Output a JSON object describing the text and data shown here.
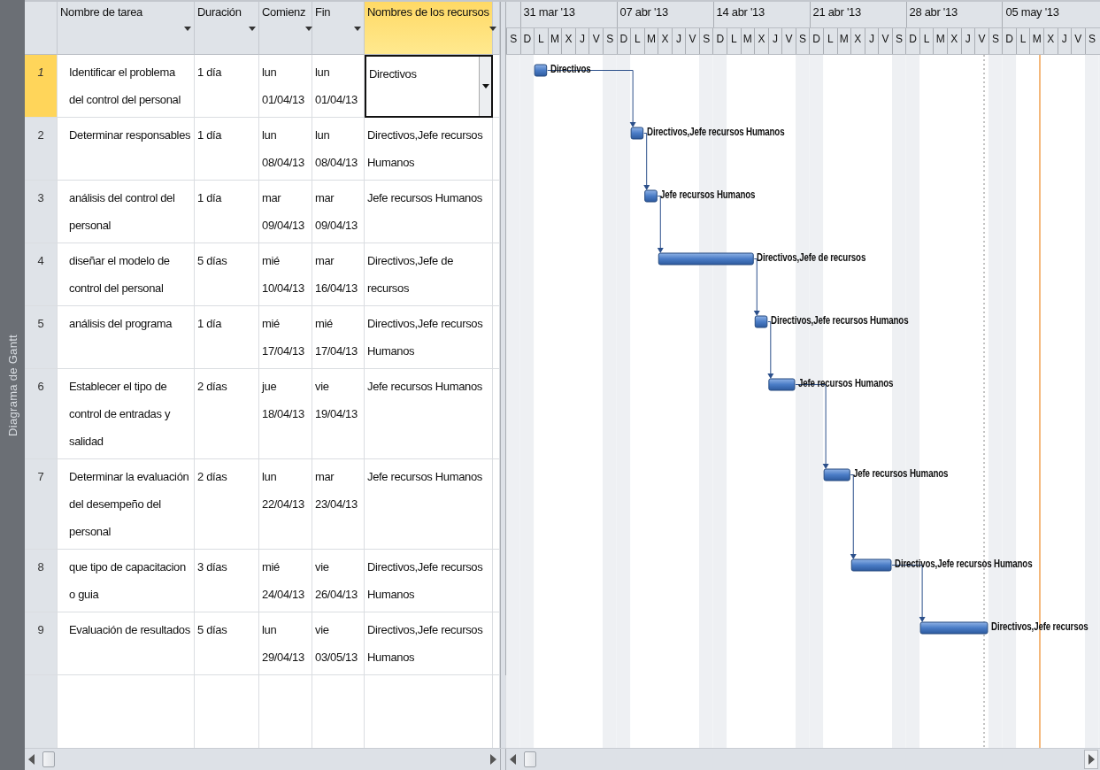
{
  "sidebar": {
    "title": "Diagrama de Gantt"
  },
  "columns": [
    {
      "label": "Nombre de tarea",
      "selected": false
    },
    {
      "label": "Duración",
      "selected": false
    },
    {
      "label": "Comienz",
      "selected": false
    },
    {
      "label": "Fin",
      "selected": false
    },
    {
      "label": "Nombres de los recursos",
      "selected": true
    }
  ],
  "timeline": {
    "weeks": [
      "31 mar '13",
      "07 abr '13",
      "14 abr '13",
      "21 abr '13",
      "28 abr '13",
      "05 may '13"
    ],
    "days": [
      "S",
      "D",
      "L",
      "M",
      "X",
      "J",
      "V",
      "S",
      "D",
      "L",
      "M",
      "X",
      "J",
      "V",
      "S",
      "D",
      "L",
      "M",
      "X",
      "J",
      "V",
      "S",
      "D",
      "L",
      "M",
      "X",
      "J",
      "V",
      "S",
      "D",
      "L",
      "M",
      "X",
      "J",
      "V",
      "S",
      "D",
      "L",
      "M",
      "X",
      "J",
      "V",
      "S"
    ]
  },
  "tasks": [
    {
      "id": "1",
      "name": "Identificar el problema del control del personal",
      "duration": "1 día",
      "start": "lun 01/04/13",
      "finish": "lun 01/04/13",
      "resources": "Directivos",
      "bar_label": "Directivos",
      "selected": true,
      "editing": true
    },
    {
      "id": "2",
      "name": "Determinar responsables",
      "duration": "1 día",
      "start": "lun 08/04/13",
      "finish": "lun 08/04/13",
      "resources": "Directivos,Jefe recursos Humanos",
      "bar_label": "Directivos,Jefe recursos Humanos",
      "selected": false,
      "editing": false
    },
    {
      "id": "3",
      "name": "análisis del control del personal",
      "duration": "1 día",
      "start": "mar 09/04/13",
      "finish": "mar 09/04/13",
      "resources": "Jefe recursos Humanos",
      "bar_label": "Jefe recursos Humanos",
      "selected": false,
      "editing": false
    },
    {
      "id": "4",
      "name": "diseñar el modelo de control del personal",
      "duration": "5 días",
      "start": "mié 10/04/13",
      "finish": "mar 16/04/13",
      "resources": "Directivos,Jefe de recursos",
      "bar_label": "Directivos,Jefe de recursos",
      "selected": false,
      "editing": false
    },
    {
      "id": "5",
      "name": "análisis del programa",
      "duration": "1 día",
      "start": "mié 17/04/13",
      "finish": "mié 17/04/13",
      "resources": "Directivos,Jefe recursos Humanos",
      "bar_label": "Directivos,Jefe recursos Humanos",
      "selected": false,
      "editing": false
    },
    {
      "id": "6",
      "name": "Establecer el tipo de control de entradas y salidad",
      "duration": "2 días",
      "start": "jue 18/04/13",
      "finish": "vie 19/04/13",
      "resources": "Jefe recursos Humanos",
      "bar_label": "Jefe recursos Humanos",
      "selected": false,
      "editing": false
    },
    {
      "id": "7",
      "name": "Determinar la evaluación del desempeño del personal",
      "duration": "2 días",
      "start": "lun 22/04/13",
      "finish": "mar 23/04/13",
      "resources": "Jefe recursos Humanos",
      "bar_label": "Jefe recursos Humanos",
      "selected": false,
      "editing": false
    },
    {
      "id": "8",
      "name": "que tipo de capacitacion o guia",
      "duration": "3 días",
      "start": "mié 24/04/13",
      "finish": "vie 26/04/13",
      "resources": "Directivos,Jefe recursos Humanos",
      "bar_label": "Directivos,Jefe recursos Humanos",
      "selected": false,
      "editing": false
    },
    {
      "id": "9",
      "name": "Evaluación de resultados",
      "duration": "5 días",
      "start": "lun 29/04/13",
      "finish": "vie 03/05/13",
      "resources": "Directivos,Jefe recursos Humanos",
      "bar_label": "Directivos,Jefe recursos",
      "selected": false,
      "editing": false
    }
  ]
}
